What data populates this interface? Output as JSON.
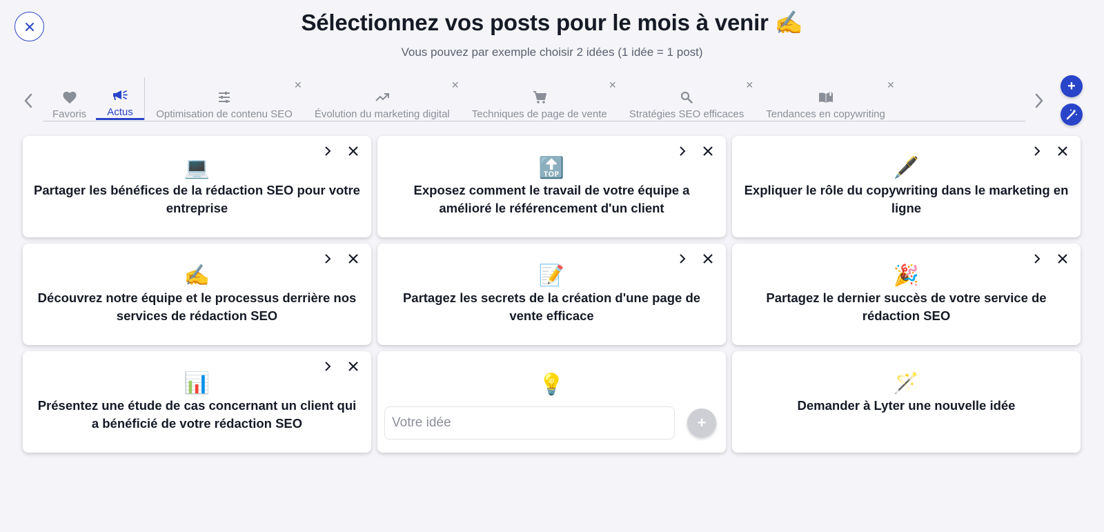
{
  "header": {
    "title": "Sélectionnez vos posts pour le mois à venir ✍️",
    "subtitle": "Vous pouvez par exemple choisir 2 idées (1 idée = 1 post)"
  },
  "tabs": [
    {
      "label": "Favoris",
      "icon": "heart-icon",
      "closable": false,
      "active": false
    },
    {
      "label": "Actus",
      "icon": "megaphone-icon",
      "closable": false,
      "active": true
    },
    {
      "label": "Optimisation de contenu SEO",
      "icon": "sliders-icon",
      "closable": true,
      "active": false
    },
    {
      "label": "Évolution du marketing digital",
      "icon": "trending-up-icon",
      "closable": true,
      "active": false
    },
    {
      "label": "Techniques de page de vente",
      "icon": "cart-icon",
      "closable": true,
      "active": false
    },
    {
      "label": "Stratégies SEO efficaces",
      "icon": "search-icon",
      "closable": true,
      "active": false
    },
    {
      "label": "Tendances en copywriting",
      "icon": "book-icon",
      "closable": true,
      "active": false
    }
  ],
  "fabs": {
    "add": "+",
    "magic": "magic-wand-icon"
  },
  "cards": [
    {
      "emoji": "💻",
      "text": "Partager les bénéfices de la rédaction SEO pour votre entreprise"
    },
    {
      "emoji": "🔝",
      "text": "Exposez comment le travail de votre équipe a amélioré le référencement d'un client"
    },
    {
      "emoji": "🖋️",
      "text": "Expliquer le rôle du copywriting dans le marketing en ligne"
    },
    {
      "emoji": "✍️",
      "text": "Découvrez notre équipe et le processus derrière nos services de rédaction SEO"
    },
    {
      "emoji": "📝",
      "text": "Partagez les secrets de la création d'une page de vente efficace"
    },
    {
      "emoji": "🎉",
      "text": "Partagez le dernier succès de votre service de rédaction SEO"
    },
    {
      "emoji": "📊",
      "text": "Présentez une étude de cas concernant un client qui a bénéficié de votre rédaction SEO"
    }
  ],
  "idea_card": {
    "emoji": "💡",
    "placeholder": "Votre idée",
    "add_label": "+"
  },
  "ask_card": {
    "emoji": "🪄",
    "text": "Demander à Lyter une nouvelle idée"
  },
  "colors": {
    "accent": "#2a44c9",
    "background": "#f5f5f9",
    "muted": "#8a8e98"
  }
}
